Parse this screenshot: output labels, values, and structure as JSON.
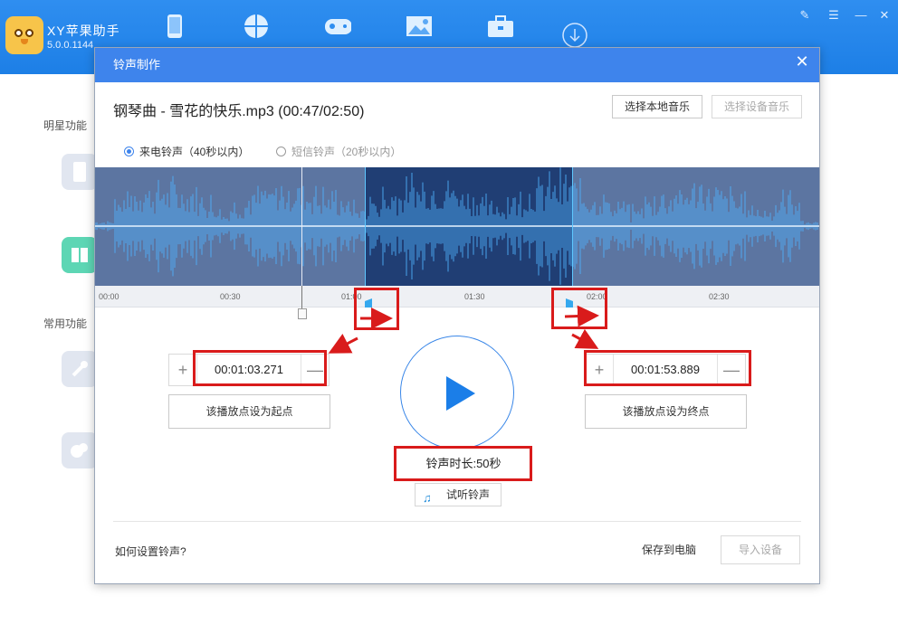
{
  "app": {
    "title": "XY苹果助手",
    "version": "5.0.0.1144"
  },
  "nav": {
    "icons": [
      "phone-icon",
      "apps-icon",
      "gamepad-icon",
      "image-icon",
      "toolbox-icon",
      "download-icon"
    ]
  },
  "window_controls": {
    "skin": "✎",
    "menu": "☰",
    "minimize": "—",
    "close": "✕"
  },
  "sidebar": {
    "star_label": "明星功能",
    "common_label": "常用功能"
  },
  "dialog": {
    "title": "铃声制作",
    "close": "✕",
    "song_title": "钢琴曲 - 雪花的快乐.mp3 (00:47/02:50)",
    "choose_local": "选择本地音乐",
    "choose_device": "选择设备音乐",
    "radio_call": "来电铃声（40秒以内）",
    "radio_sms": "短信铃声（20秒以内）",
    "timeline": [
      "00:00",
      "00:30",
      "01:00",
      "01:30",
      "02:00",
      "02:30"
    ],
    "start_time": "00:01:03.271",
    "end_time": "00:01:53.889",
    "plus": "+",
    "minus": "—",
    "set_start": "该播放点设为起点",
    "set_end": "该播放点设为终点",
    "duration": "铃声时长:50秒",
    "preview": "试听铃声",
    "howto": "如何设置铃声?",
    "save_pc": "保存到电脑",
    "import": "导入设备"
  },
  "colors": {
    "accent": "#3e84ec",
    "annotation": "#d91b1b",
    "wave_selected": "#203e74",
    "wave_bg": "#5c75a1"
  }
}
